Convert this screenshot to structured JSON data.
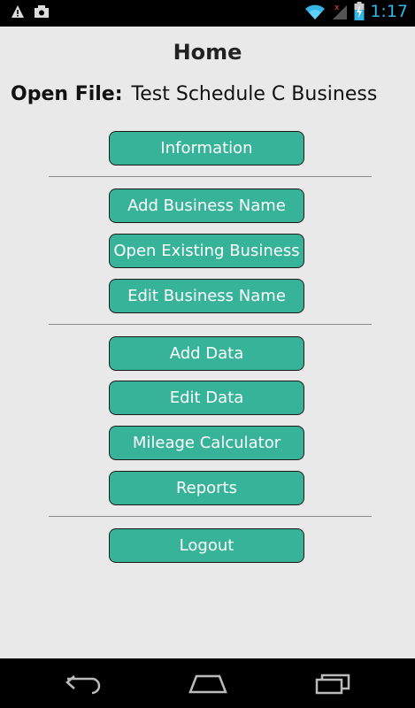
{
  "status_bar": {
    "time": "1:17",
    "left_icons": [
      "warning-icon",
      "photo-notification-icon"
    ],
    "right_icons": [
      "wifi-icon",
      "signal-icon",
      "battery-charging-icon"
    ],
    "time_color": "#33b5e5"
  },
  "header": {
    "title": "Home"
  },
  "open_file": {
    "label": "Open File:",
    "value": "Test Schedule C Business"
  },
  "buttons": {
    "information": "Information",
    "add_business_name": "Add Business Name",
    "open_existing_business": "Open Existing Business",
    "edit_business_name": "Edit Business Name",
    "add_data": "Add Data",
    "edit_data": "Edit Data",
    "mileage_calculator": "Mileage Calculator",
    "reports": "Reports",
    "logout": "Logout"
  },
  "colors": {
    "button_bg": "#37b399",
    "background": "#e9e9e9"
  },
  "nav_bar": {
    "icons": [
      "back-icon",
      "home-icon",
      "recent-apps-icon"
    ]
  }
}
